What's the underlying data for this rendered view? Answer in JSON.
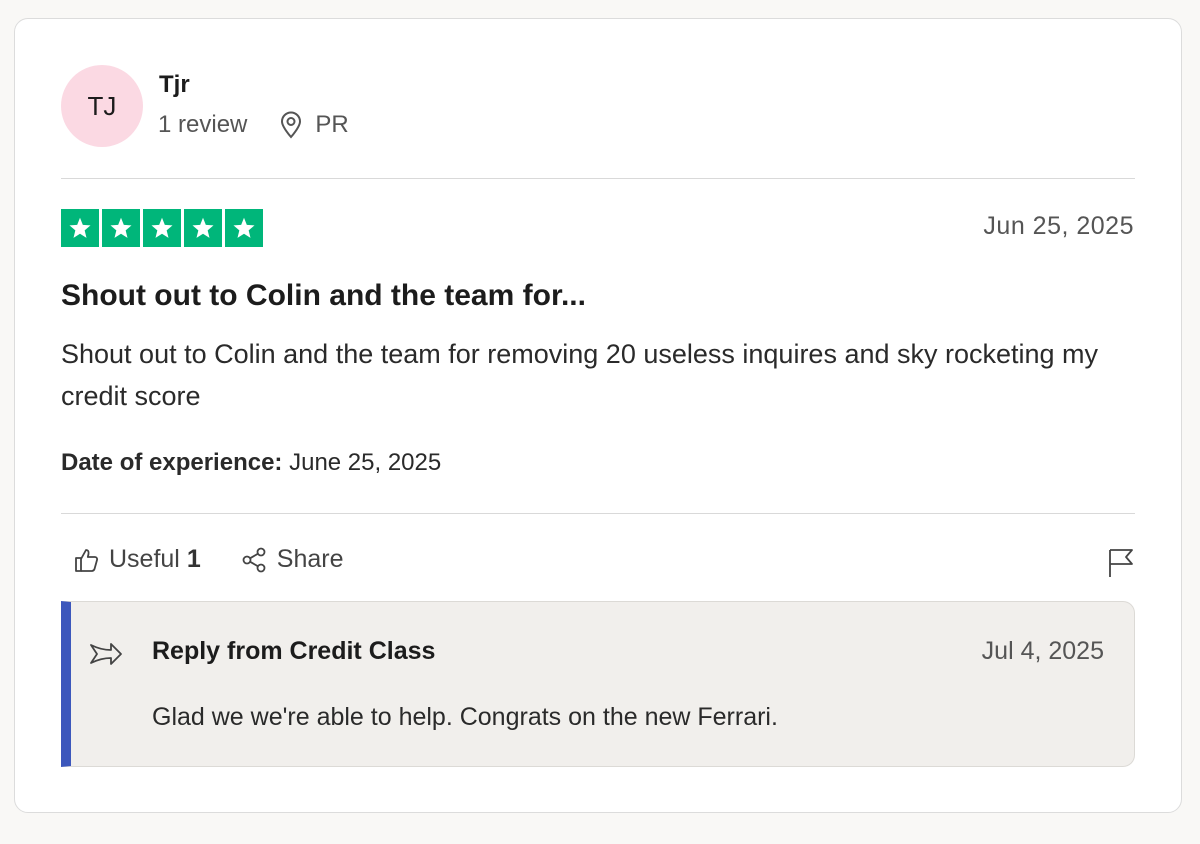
{
  "reviewer": {
    "initials": "TJ",
    "name": "Tjr",
    "review_count": "1 review",
    "location": "PR",
    "location_icon": "location-pin-icon",
    "avatar_color": "#fbd9e3"
  },
  "review": {
    "rating": 5,
    "rating_max": 5,
    "star_color": "#00b67a",
    "date": "Jun 25, 2025",
    "title": "Shout out to Colin and the team for...",
    "body": "Shout out to Colin and the team for removing 20 useless inquires and sky rocketing my credit score",
    "experience_label": "Date of experience:",
    "experience_date": "June 25, 2025"
  },
  "actions": {
    "useful_label": "Useful",
    "useful_count": "1",
    "useful_icon": "thumbs-up-icon",
    "share_label": "Share",
    "share_icon": "share-icon",
    "flag_icon": "flag-icon"
  },
  "reply": {
    "icon": "reply-arrow-icon",
    "from": "Reply from Credit Class",
    "date": "Jul 4, 2025",
    "text": "Glad we we're able to help. Congrats on the new Ferrari.",
    "accent_color": "#3c57bc"
  }
}
